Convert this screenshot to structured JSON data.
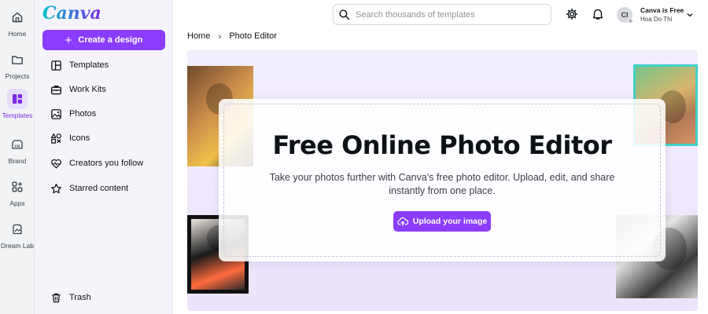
{
  "rail": {
    "items": [
      {
        "label": "Home",
        "icon": "home-icon"
      },
      {
        "label": "Projects",
        "icon": "folder-icon"
      },
      {
        "label": "Templates",
        "icon": "templates-icon",
        "active": true
      },
      {
        "label": "Brand",
        "icon": "brand-icon"
      },
      {
        "label": "Apps",
        "icon": "apps-icon"
      },
      {
        "label": "Dream Lab",
        "icon": "dream-lab-icon"
      }
    ]
  },
  "sidebar": {
    "logo": "Canva",
    "create_label": "Create a design",
    "items": [
      {
        "label": "Templates",
        "icon": "layout-icon"
      },
      {
        "label": "Work Kits",
        "icon": "briefcase-icon"
      },
      {
        "label": "Photos",
        "icon": "image-icon"
      },
      {
        "label": "Icons",
        "icon": "shapes-icon"
      },
      {
        "label": "Creators you follow",
        "icon": "heart-pulse-icon"
      },
      {
        "label": "Starred content",
        "icon": "star-icon"
      }
    ],
    "trash_label": "Trash"
  },
  "header": {
    "search_placeholder": "Search thousands of templates",
    "account": {
      "initials": "CI",
      "plan": "Canva is Free",
      "name": "Hoa Do Thi"
    }
  },
  "breadcrumb": {
    "home": "Home",
    "current": "Photo Editor"
  },
  "hero": {
    "title": "Free Online Photo Editor",
    "description": "Take your photos further with Canva's free photo editor. Upload, edit, and share instantly from one place.",
    "upload_label": "Upload your image"
  },
  "colors": {
    "brand_purple": "#8b3dff",
    "accent_teal": "#00c4cc",
    "hero_bg": "#f3eefd"
  }
}
